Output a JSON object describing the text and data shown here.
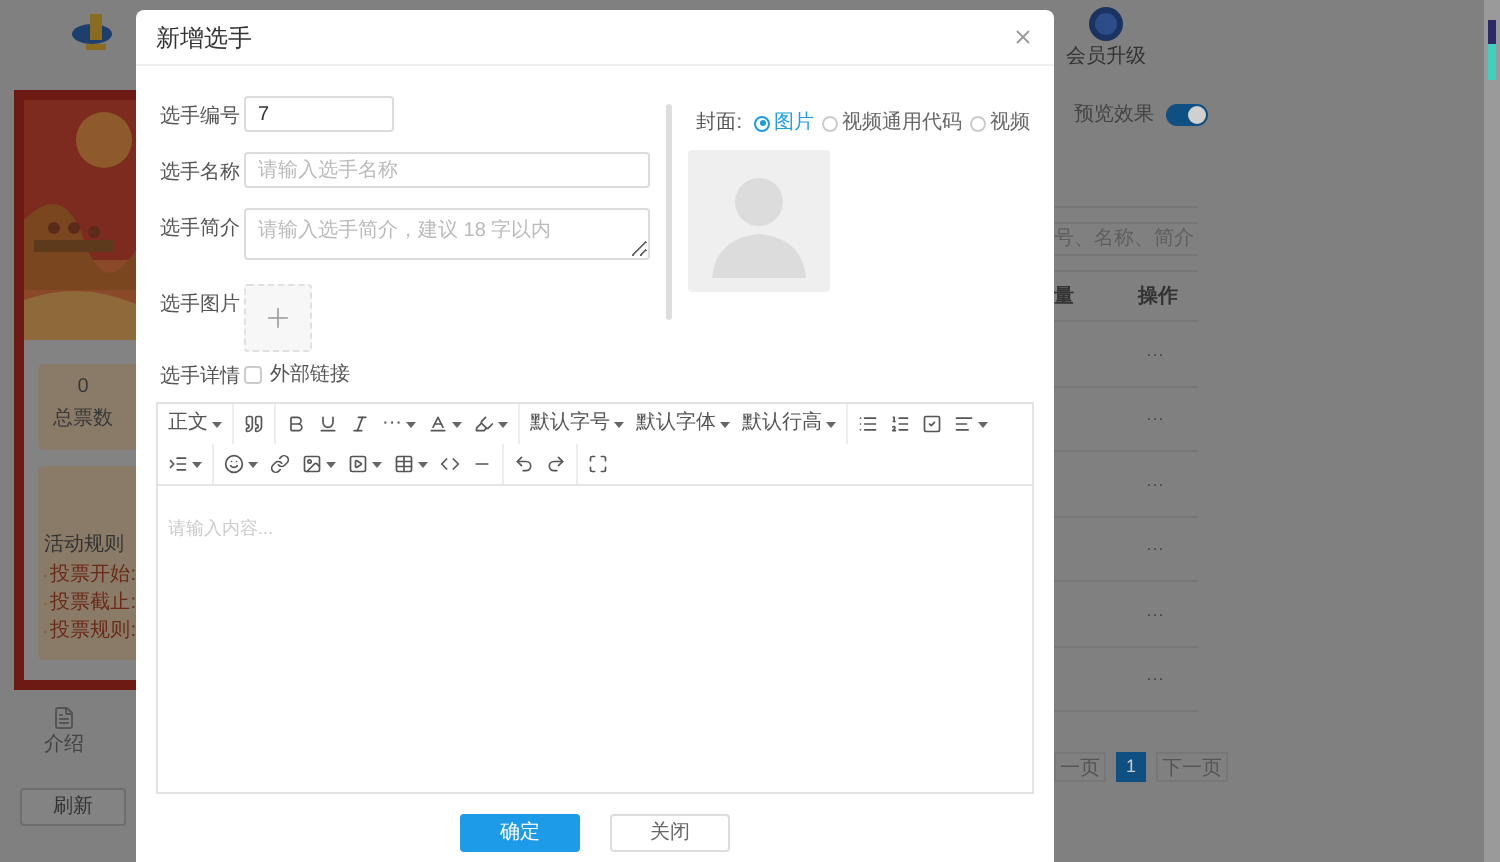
{
  "background": {
    "vip_label": "会员升级",
    "preview": {
      "label": "预览效果",
      "on": true
    },
    "total_votes": {
      "value": "0",
      "label": "总票数"
    },
    "rules": {
      "title": "活动规则",
      "items": [
        "投票开始:",
        "投票截止:",
        "投票规则:"
      ]
    },
    "intro_label": "介绍",
    "refresh_button": "刷新",
    "search": {
      "placeholder": "号、名称、简介"
    },
    "table": {
      "columns": [
        "量",
        "操作"
      ],
      "rows": [
        {
          "action": "···"
        },
        {
          "action": "···"
        },
        {
          "action": "···"
        },
        {
          "action": "···"
        },
        {
          "action": "···"
        },
        {
          "action": "···"
        }
      ]
    },
    "pagination": {
      "prev": "一页",
      "pages": [
        {
          "label": "1",
          "selected": true
        }
      ],
      "next": "下一页"
    }
  },
  "dialog": {
    "title": "新增选手",
    "fields": [
      {
        "kind": "input",
        "label": "选手编号",
        "value": "7"
      },
      {
        "kind": "input",
        "label": "选手名称",
        "placeholder": "请输入选手名称"
      },
      {
        "kind": "textarea",
        "label": "选手简介",
        "placeholder": "请输入选手简介，建议 18 字以内"
      },
      {
        "kind": "upload",
        "label": "选手图片"
      },
      {
        "kind": "checkbox",
        "label": "选手详情",
        "option": "外部链接",
        "checked": false
      }
    ],
    "cover": {
      "label": "封面:",
      "options": [
        {
          "label": "图片",
          "selected": true
        },
        {
          "label": "视频通用代码",
          "selected": false
        },
        {
          "label": "视频",
          "selected": false
        }
      ]
    },
    "editor": {
      "toolbar": [
        [
          [
            {
              "kind": "text",
              "label": "正文",
              "dropdown": true
            }
          ],
          [
            {
              "kind": "icon",
              "dropdown": false
            }
          ],
          [
            {
              "kind": "icon",
              "dropdown": false
            },
            {
              "kind": "icon",
              "dropdown": false
            },
            {
              "kind": "icon",
              "dropdown": false
            },
            {
              "kind": "text",
              "label": "···",
              "dropdown": true
            },
            {
              "kind": "icon",
              "dropdown": true
            },
            {
              "kind": "icon",
              "dropdown": true
            }
          ],
          [
            {
              "kind": "text",
              "label": "默认字号",
              "dropdown": true
            },
            {
              "kind": "text",
              "label": "默认字体",
              "dropdown": true
            },
            {
              "kind": "text",
              "label": "默认行高",
              "dropdown": true
            }
          ],
          [
            {
              "kind": "icon",
              "dropdown": false
            },
            {
              "kind": "icon",
              "dropdown": false
            },
            {
              "kind": "icon",
              "dropdown": false
            },
            {
              "kind": "icon",
              "dropdown": true
            }
          ]
        ],
        [
          [
            {
              "kind": "icon",
              "dropdown": true
            }
          ],
          [
            {
              "kind": "icon",
              "dropdown": true
            },
            {
              "kind": "icon",
              "dropdown": false
            },
            {
              "kind": "icon",
              "dropdown": true
            },
            {
              "kind": "icon",
              "dropdown": true
            },
            {
              "kind": "icon",
              "dropdown": true
            },
            {
              "kind": "icon",
              "dropdown": false
            },
            {
              "kind": "icon",
              "dropdown": false
            }
          ],
          [
            {
              "kind": "icon",
              "dropdown": false
            },
            {
              "kind": "icon",
              "dropdown": false
            }
          ],
          [
            {
              "kind": "icon",
              "dropdown": false
            }
          ]
        ]
      ],
      "placeholder": "请输入内容..."
    },
    "buttons": [
      {
        "label": "确定",
        "kind": "primary"
      },
      {
        "label": "关闭",
        "kind": "default"
      }
    ]
  }
}
